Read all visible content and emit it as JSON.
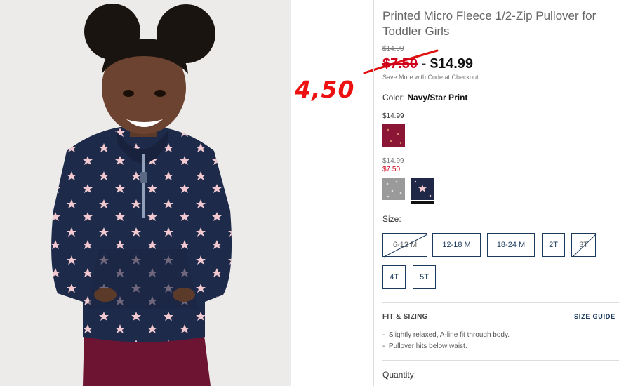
{
  "product": {
    "title": "Printed Micro Fleece 1/2-Zip Pullover for Toddler Girls",
    "original_price": "$14.99",
    "sale_price": "$7.50",
    "dash": "-",
    "regular_price": "$14.99",
    "promo": "Save More with Code at Checkout"
  },
  "annotation": {
    "handwritten": "4,50",
    "color": "#e01010"
  },
  "color": {
    "label": "Color:",
    "selected": "Navy/Star Print",
    "groups": [
      {
        "price": "$14.99",
        "swatches": [
          {
            "name": "Burgundy print",
            "hex": "#8a1535"
          }
        ]
      },
      {
        "original": "$14.99",
        "sale": "$7.50",
        "swatches": [
          {
            "name": "Gray print",
            "hex": "#9a9a9a"
          },
          {
            "name": "Navy/Star Print",
            "hex": "#1f2847",
            "selected": true
          }
        ]
      }
    ]
  },
  "size": {
    "label": "Size:",
    "options": [
      {
        "label": "6-12 M",
        "available": false
      },
      {
        "label": "12-18 M",
        "available": true
      },
      {
        "label": "18-24 M",
        "available": true
      },
      {
        "label": "2T",
        "available": true
      },
      {
        "label": "3T",
        "available": false
      },
      {
        "label": "4T",
        "available": true
      },
      {
        "label": "5T",
        "available": true
      }
    ]
  },
  "fit": {
    "heading": "FIT & SIZING",
    "size_guide": "SIZE GUIDE",
    "bullets": [
      "Slightly relaxed, A-line fit through body.",
      "Pullover hits below waist."
    ]
  },
  "quantity_label": "Quantity:",
  "colors": {
    "accent_navy": "#1b3a5c",
    "sale_red": "#d0021b"
  }
}
